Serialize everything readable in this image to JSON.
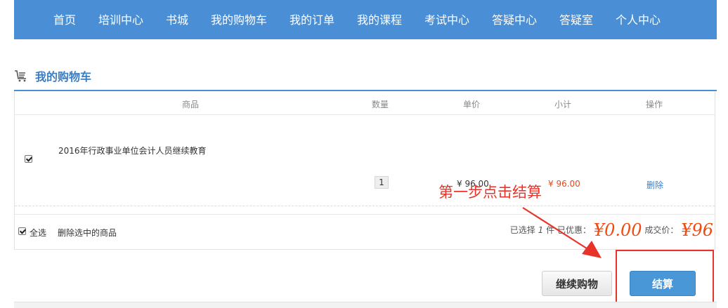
{
  "nav": {
    "items": [
      "首页",
      "培训中心",
      "书城",
      "我的购物车",
      "我的订单",
      "我的课程",
      "考试中心",
      "答疑中心",
      "答疑室",
      "个人中心"
    ]
  },
  "section": {
    "title": "我的购物车",
    "icon": "cart-icon"
  },
  "table": {
    "headers": [
      "商品",
      "数量",
      "单价",
      "小计",
      "操作"
    ],
    "rows": [
      {
        "checked": true,
        "name": "2016年行政事业单位会计人员继续教育",
        "quantity": "1",
        "price": "¥ 96.00",
        "subtotal": "¥ 96.00",
        "action": "删除"
      }
    ]
  },
  "footer": {
    "select_all": "全选",
    "delete_selected": "删除选中的商品",
    "selected_prefix": "已选择",
    "selected_count": "1",
    "selected_suffix": "件",
    "discount_label": "已优惠：",
    "discount_value": "¥0.00",
    "total_label": "成交价：",
    "total_value": "¥96"
  },
  "buttons": {
    "continue": "继续购物",
    "checkout": "结算"
  },
  "annotation": {
    "text": "第一步点击结算",
    "color": "#e8332a"
  },
  "colors": {
    "nav_bg": "#4a8fd6",
    "accent": "#3a7dc4",
    "price_red": "#f04a10"
  }
}
